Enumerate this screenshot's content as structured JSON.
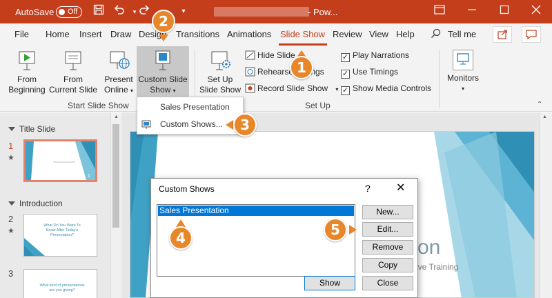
{
  "titlebar": {
    "autosave_label": "AutoSave",
    "autosave_state": "Off",
    "app_suffix": "- Pow...",
    "icons": [
      "save-icon",
      "undo-icon",
      "redo-icon",
      "customize-toolbar-icon",
      "restore-window-icon",
      "minimize-icon",
      "maximize-icon",
      "close-icon"
    ]
  },
  "menu": {
    "tabs": [
      "File",
      "Home",
      "Insert",
      "Draw",
      "Design",
      "Transitions",
      "Animations",
      "Slide Show",
      "Review",
      "View",
      "Help"
    ],
    "active_tab": "Slide Show",
    "tell_me": "Tell me"
  },
  "ribbon": {
    "from_beginning": [
      "From",
      "Beginning"
    ],
    "from_current": [
      "From",
      "Current Slide"
    ],
    "present_online": [
      "Present",
      "Online"
    ],
    "custom_show": [
      "Custom Slide",
      "Show"
    ],
    "set_up_show": [
      "Set Up",
      "Slide Show"
    ],
    "hide_slide": "Hide Slide",
    "rehearse_timings": "Rehearse Timings",
    "record_slide_show": "Record Slide Show",
    "play_narrations": "Play Narrations",
    "use_timings": "Use Timings",
    "show_media_controls": "Show Media Controls",
    "monitors": "Monitors",
    "group_start": "Start Slide Show",
    "group_setup": "Set Up"
  },
  "dropdown": {
    "items": [
      "Sales Presentation",
      "Custom Shows..."
    ]
  },
  "slides_pane": {
    "sections": [
      "Title Slide",
      "Introduction"
    ],
    "slides": [
      {
        "num": "1",
        "star": "★",
        "text": ""
      },
      {
        "num": "2",
        "star": "★",
        "text": "What Do You Want To Know After Today's Presentation?"
      },
      {
        "num": "3",
        "star": "",
        "text": "What kind of presentations are you giving?"
      }
    ]
  },
  "slide": {
    "title_fragment": "tion",
    "subtitle_fragment": "ive Training"
  },
  "dialog": {
    "title": "Custom Shows",
    "help": "?",
    "close": "✕",
    "list_items": [
      "Sales Presentation"
    ],
    "buttons": {
      "new": "New...",
      "edit": "Edit...",
      "remove": "Remove",
      "copy": "Copy",
      "show": "Show",
      "close": "Close"
    }
  },
  "callouts": [
    "1",
    "2",
    "3",
    "4",
    "5"
  ],
  "colors": {
    "accent": "#c43e1c",
    "callout": "#e8862a",
    "selection": "#0078d7",
    "slide_teal": "#3fa1c4"
  }
}
